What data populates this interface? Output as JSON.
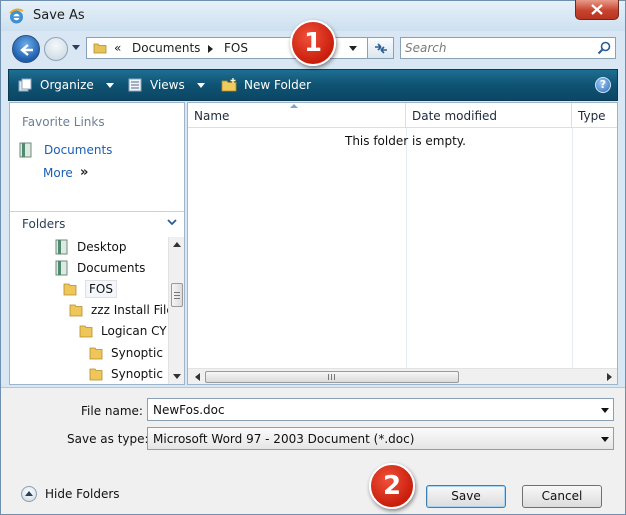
{
  "window": {
    "title": "Save As",
    "close_label": "close"
  },
  "address": {
    "overflow": "«",
    "segments": [
      "Documents",
      "FOS"
    ]
  },
  "search": {
    "placeholder": "Search"
  },
  "toolbar": {
    "organize_label": "Organize",
    "views_label": "Views",
    "new_folder_label": "New Folder",
    "help_label": "?"
  },
  "nav": {
    "favorite_links_header": "Favorite Links",
    "favorites": [
      {
        "label": "Documents",
        "icon": "documents-icon"
      }
    ],
    "more_label": "More",
    "more_arrow": "»",
    "folders_header": "Folders",
    "tree": [
      {
        "label": "Desktop",
        "icon": "desktop-icon",
        "level": 0
      },
      {
        "label": "Documents",
        "icon": "documents-icon",
        "level": 0
      },
      {
        "label": "FOS",
        "icon": "folder-icon",
        "level": 1,
        "selected": true
      },
      {
        "label": "zzz Install Files",
        "icon": "folder-icon",
        "level": 1
      },
      {
        "label": "Logican CY",
        "icon": "folder-icon",
        "level": 2
      },
      {
        "label": "Synoptic",
        "icon": "folder-icon",
        "level": 3
      },
      {
        "label": "Synoptic",
        "icon": "folder-icon",
        "level": 3
      }
    ]
  },
  "file_list": {
    "columns": [
      "Name",
      "Date modified",
      "Type"
    ],
    "empty_message": "This folder is empty."
  },
  "form": {
    "file_name_label": "File name:",
    "file_name_value": "NewFos.doc",
    "save_type_label": "Save as type:",
    "save_type_value": "Microsoft Word 97 - 2003 Document (*.doc)",
    "hide_folders_label": "Hide Folders",
    "save_label": "Save",
    "cancel_label": "Cancel"
  },
  "callouts": [
    "1",
    "2"
  ],
  "colors": {
    "toolbar": "#0f5272",
    "link": "#1a5fb4",
    "callout": "#d52a14"
  }
}
